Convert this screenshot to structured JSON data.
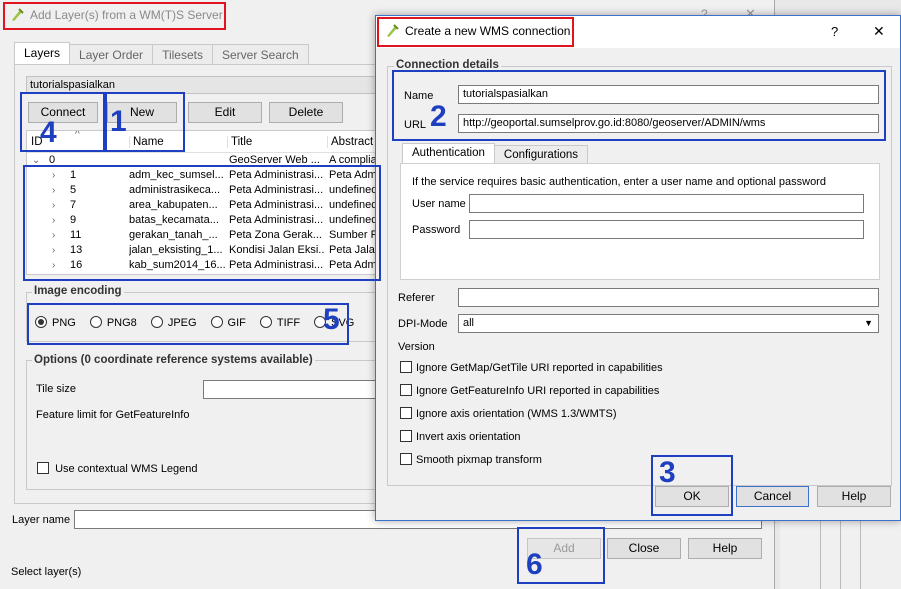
{
  "bg_dialog": {
    "title": "Add Layer(s) from a WM(T)S Server",
    "help_glyph": "?",
    "close_glyph": "✕",
    "tabs": [
      "Layers",
      "Layer Order",
      "Tilesets",
      "Server Search"
    ],
    "connection_value": "tutorialspasialkan",
    "buttons": {
      "connect": "Connect",
      "new": "New",
      "edit": "Edit",
      "delete": "Delete"
    },
    "columns": [
      "ID",
      "Name",
      "Title",
      "Abstract"
    ],
    "rows": [
      {
        "id": "0",
        "name": "",
        "title": "GeoServer Web ...",
        "abstract": "A complian"
      },
      {
        "id": "1",
        "name": "adm_kec_sumsel...",
        "title": "Peta Administrasi...",
        "abstract": "Peta Adm"
      },
      {
        "id": "5",
        "name": "administrasikeca...",
        "title": "Peta Administrasi...",
        "abstract": "undefined"
      },
      {
        "id": "7",
        "name": "area_kabupaten...",
        "title": "Peta Administrasi...",
        "abstract": "undefined"
      },
      {
        "id": "9",
        "name": "batas_kecamata...",
        "title": "Peta Administrasi...",
        "abstract": "undefined"
      },
      {
        "id": "11",
        "name": "gerakan_tanah_...",
        "title": "Peta Zona Gerak...",
        "abstract": "Sumber Pe"
      },
      {
        "id": "13",
        "name": "jalan_eksisting_1...",
        "title": "Kondisi Jalan Eksi...",
        "abstract": "Peta Jalan"
      },
      {
        "id": "16",
        "name": "kab_sum2014_16...",
        "title": "Peta Administrasi...",
        "abstract": "Peta Adm"
      }
    ],
    "image_encoding": {
      "title": "Image encoding",
      "options": [
        "PNG",
        "PNG8",
        "JPEG",
        "GIF",
        "TIFF",
        "SVG"
      ],
      "selected": "PNG"
    },
    "options": {
      "title": "Options (0 coordinate reference systems available)",
      "tile_size_label": "Tile size",
      "feature_limit_label": "Feature limit for GetFeatureInfo",
      "contextual_legend_label": "Use contextual WMS Legend"
    },
    "layer_name_label": "Layer name",
    "select_layers_label": "Select layer(s)",
    "bottom_buttons": {
      "add": "Add",
      "close": "Close",
      "help": "Help"
    }
  },
  "wms_dialog": {
    "title": "Create a new WMS connection",
    "help_glyph": "?",
    "close_glyph": "✕",
    "group_title": "Connection details",
    "name_label": "Name",
    "name_value": "tutorialspasialkan",
    "url_label": "URL",
    "url_value": "http://geoportal.sumselprov.go.id:8080/geoserver/ADMIN/wms",
    "tabs": [
      "Authentication",
      "Configurations"
    ],
    "auth_info": "If the service requires basic authentication, enter a user name and optional password",
    "user_label": "User name",
    "password_label": "Password",
    "referer_label": "Referer",
    "dpi_label": "DPI-Mode",
    "dpi_value": "all",
    "version_label": "Version",
    "checkboxes": [
      "Ignore GetMap/GetTile URI reported in capabilities",
      "Ignore GetFeatureInfo URI reported in capabilities",
      "Ignore axis orientation (WMS 1.3/WMTS)",
      "Invert axis orientation",
      "Smooth pixmap transform"
    ],
    "buttons": {
      "ok": "OK",
      "cancel": "Cancel",
      "help": "Help"
    }
  },
  "annotations": [
    "1",
    "2",
    "3",
    "4",
    "5",
    "6"
  ],
  "colors": {
    "annotation_blue": "#1e3fbf",
    "annotation_red": "#e0141e",
    "accent": "#3c73c8"
  }
}
